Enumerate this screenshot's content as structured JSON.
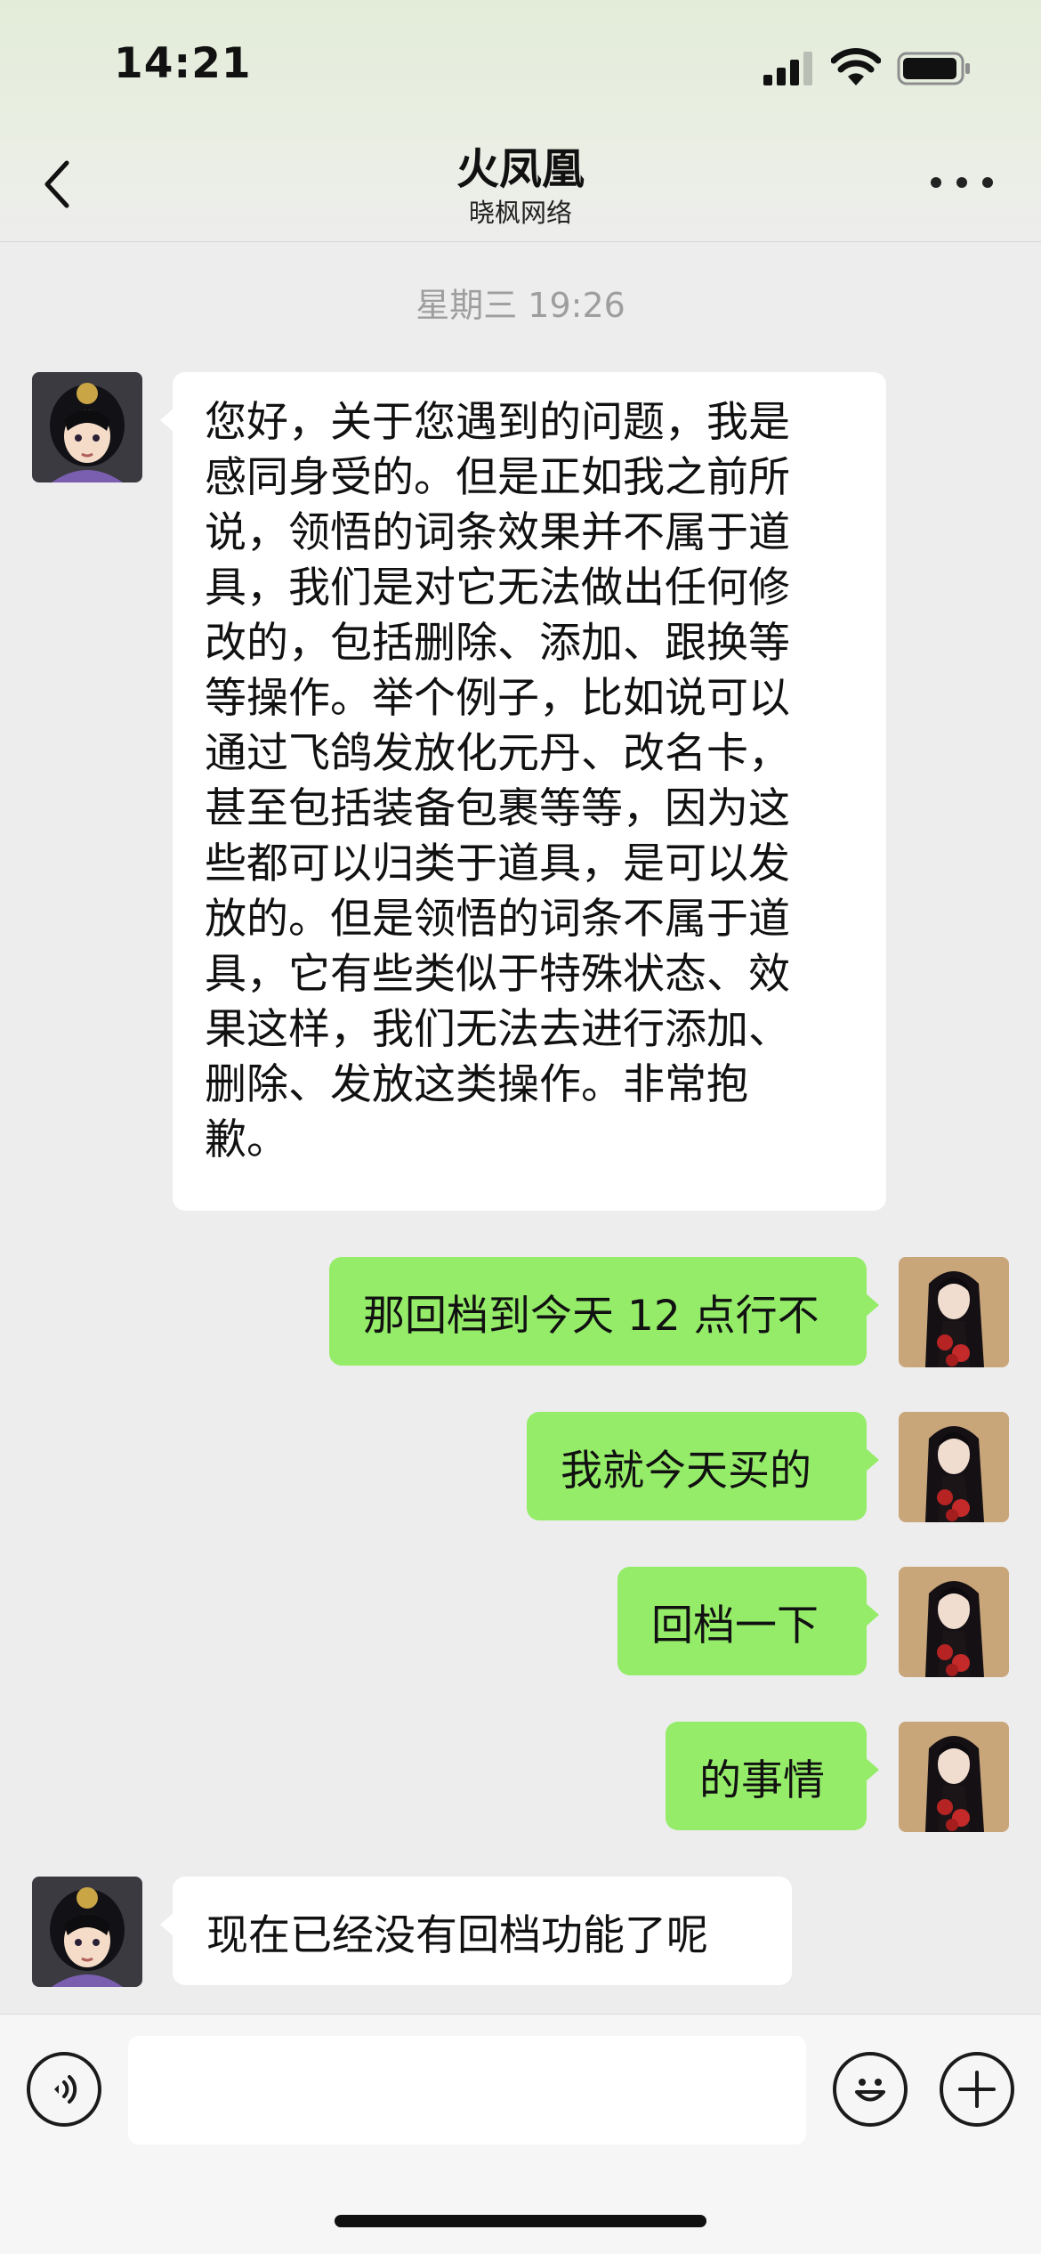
{
  "status_bar": {
    "time": "14:21"
  },
  "header": {
    "title": "火凤凰",
    "subtitle": "晓枫网络"
  },
  "timestamp": "星期三 19:26",
  "messages": [
    {
      "side": "left",
      "lines": [
        "您好，关于您遇到的问题，我是",
        "感同身受的。但是正如我之前所",
        "说，领悟的词条效果并不属于道",
        "具，我们是对它无法做出任何修",
        "改的，包括删除、添加、跟换等",
        "等操作。举个例子，比如说可以",
        "通过飞鸽发放化元丹、改名卡，",
        "甚至包括装备包裹等等，因为这",
        "些都可以归类于道具，是可以发",
        "放的。但是领悟的词条不属于道",
        "具，它有些类似于特殊状态、效",
        "果这样，我们无法去进行添加、",
        "删除、发放这类操作。非常抱",
        "歉。"
      ]
    },
    {
      "side": "right",
      "text": "那回档到今天 12 点行不"
    },
    {
      "side": "right",
      "text": "我就今天买的"
    },
    {
      "side": "right",
      "text": "回档一下"
    },
    {
      "side": "right",
      "text": "的事情"
    },
    {
      "side": "left",
      "text": "现在已经没有回档功能了呢"
    }
  ],
  "icons": {
    "back": "chevron-left-icon",
    "more": "more-dots-icon",
    "voice": "voice-icon",
    "emoji": "emoji-icon",
    "plus": "plus-icon"
  },
  "colors": {
    "chat_background": "#ededed",
    "incoming_bubble": "#ffffff",
    "outgoing_bubble": "#95ec69",
    "timestamp": "#9e9e9e"
  }
}
